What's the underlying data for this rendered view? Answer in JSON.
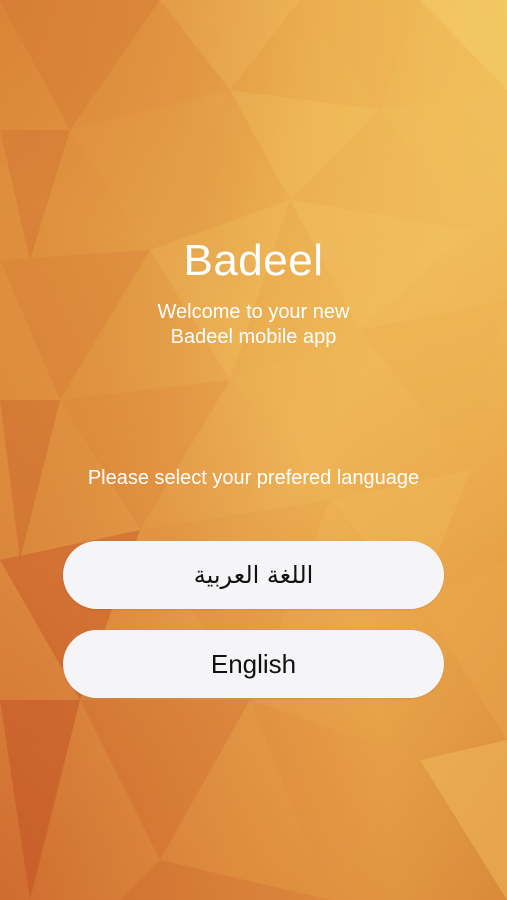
{
  "app": {
    "title": "Badeel",
    "welcome_line1": "Welcome to your new",
    "welcome_line2": "Badeel mobile app"
  },
  "language": {
    "prompt": "Please select your prefered language",
    "options": [
      {
        "label": "اللغة العربية"
      },
      {
        "label": "English"
      }
    ]
  },
  "colors": {
    "background_light": "#eeb457",
    "background_dark": "#c45222",
    "button_bg": "#f5f5f7",
    "text": "#ffffff"
  }
}
